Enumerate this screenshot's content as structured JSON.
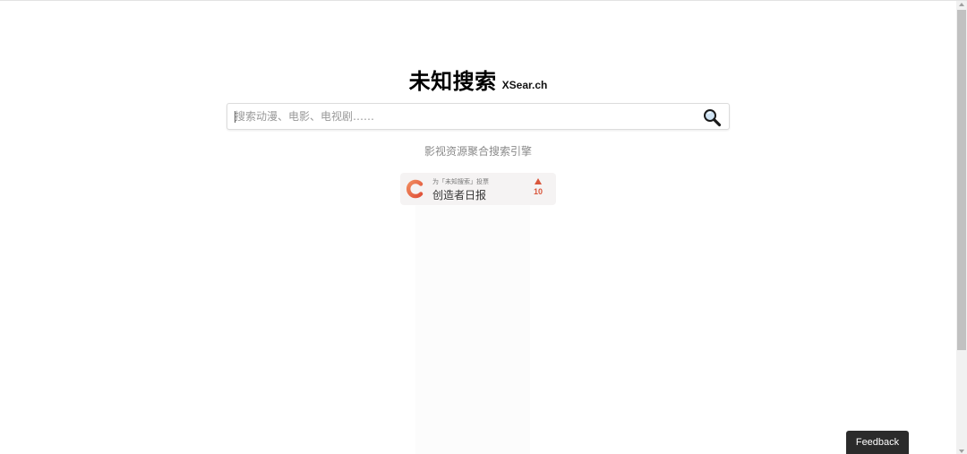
{
  "header": {
    "title": "未知搜索",
    "subtitle": "XSear.ch"
  },
  "search": {
    "placeholder": "搜索动漫、电影、电视剧……",
    "value": "",
    "button_icon": "search-icon"
  },
  "tagline": "影视资源聚合搜索引擎",
  "badge": {
    "small_text": "为「未知搜索」投票",
    "name": "创造者日报",
    "vote_count": "10",
    "vote_icon": "upvote-arrow-icon",
    "logo_icon": "creator-daily-logo-icon",
    "accent_color": "#d9563b"
  },
  "feedback": {
    "label": "Feedback"
  }
}
